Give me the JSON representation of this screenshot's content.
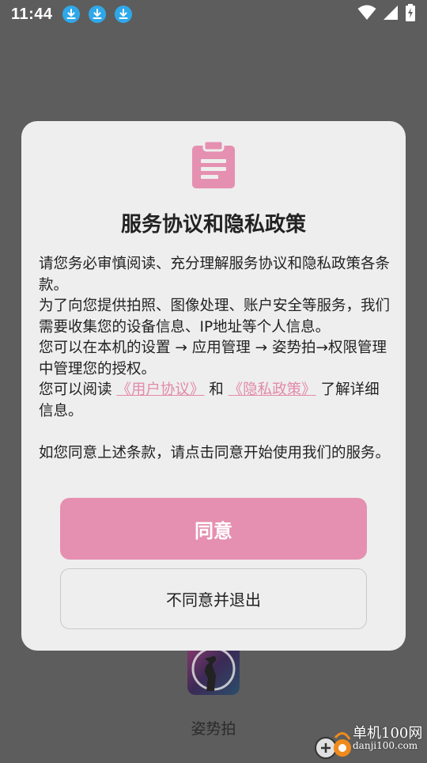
{
  "status_bar": {
    "time": "11:44",
    "download_icons": [
      "download-icon",
      "download-icon",
      "download-icon"
    ],
    "right_icons": [
      "wifi-icon",
      "cellular-signal-icon",
      "battery-charging-icon"
    ]
  },
  "background_app": {
    "name": "姿势拍"
  },
  "dialog": {
    "icon": "clipboard-document-icon",
    "title": "服务协议和隐私政策",
    "paragraph1": "请您务必审慎阅读、充分理解服务协议和隐私政策各条款。",
    "paragraph2": "为了向您提供拍照、图像处理、账户安全等服务，我们需要收集您的设备信息、IP地址等个人信息。",
    "paragraph3": "您可以在本机的设置 → 应用管理 → 姿势拍→权限管理中管理您的授权。",
    "paragraph4_prefix": "您可以阅读 ",
    "user_agreement_link": "《用户协议》",
    "paragraph4_mid": " 和 ",
    "privacy_policy_link": "《隐私政策》",
    "paragraph4_suffix": " 了解详细信息。",
    "paragraph5": "如您同意上述条款，请点击同意开始使用我们的服务。",
    "agree_label": "同意",
    "decline_label": "不同意并退出"
  },
  "watermark": {
    "cn": "单机100网",
    "en": "danji100.com"
  },
  "colors": {
    "accent_pink": "#e590b0",
    "link_pink": "#e38aaa",
    "dialog_bg": "#eeeeee",
    "scrim": "#5d5d5d",
    "download_blue": "#2fa8ea"
  }
}
